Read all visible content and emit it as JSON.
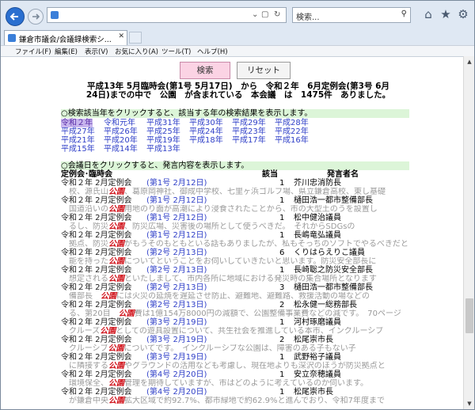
{
  "browser": {
    "address_value": "",
    "search_placeholder": "検索...",
    "tab_title": "鎌倉市議会/会議録検索シ...",
    "menu": [
      "ファイル(F)",
      "編集(E)",
      "表示(V)",
      "お気に入り(A)",
      "ツール(T)",
      "ヘルプ(H)"
    ]
  },
  "buttons": {
    "search": "検索",
    "reset": "リセット"
  },
  "summary": {
    "line1": "平成13年 5月臨時会(第1号 5月17日)　から　令和２年　6月定例会(第3号 6月",
    "line2": "24日)までの中で　公園　が含まれている　本会議　は　1475件　ありました。"
  },
  "year_notice": "○検索該当年をクリックすると、該当する年の検索結果を表示します。",
  "years": [
    "令和２年",
    "令和元年",
    "平成31年",
    "平成30年",
    "平成29年",
    "平成28年",
    "平成27年",
    "平成26年",
    "平成25年",
    "平成24年",
    "平成23年",
    "平成22年",
    "平成21年",
    "平成20年",
    "平成19年",
    "平成18年",
    "平成17年",
    "平成16年",
    "平成15年",
    "平成14年",
    "平成13年"
  ],
  "day_notice": "○会議日をクリックすると、発言内容を表示します。",
  "table_header": {
    "meeting": "定例会･臨時会",
    "count": "該当",
    "speaker": "発言者名"
  },
  "rows": [
    {
      "meeting": "令和２年 2月定例会",
      "date": "(第1号 2月12日)",
      "count": "1",
      "speaker": "芥川忠消防長",
      "snip_pre": "　校、源氏山",
      "snip_hl": "公園",
      "snip_post": "、葛原岡神社、御成中学校、七里ヶ浜ゴルフ場、県立鎌倉高校、東し基礎"
    },
    {
      "meeting": "令和２年 2月定例会",
      "date": "(第1号 2月12日)",
      "count": "1",
      "speaker": "樋田浩一都市整備部長",
      "snip_pre": "　国道沿いの",
      "snip_hl": "公園",
      "snip_post": "用地のり面が高潮により浸食されたことから、市の大型土のうを設置し"
    },
    {
      "meeting": "令和２年 2月定例会",
      "date": "(第1号 2月12日)",
      "count": "1",
      "speaker": "松中健治議員",
      "snip_pre": "　るし、防災",
      "snip_hl": "公園",
      "snip_post": "、防災広場、災害後の場所として使うべきだ。　それからSDGsの"
    },
    {
      "meeting": "令和２年 2月定例会",
      "date": "(第1号 2月12日)",
      "count": "1",
      "speaker": "長嶋竜弘議員",
      "snip_pre": "　拠点、防災",
      "snip_hl": "公園",
      "snip_post": "がもうそのもともといる話もありましたが、私もそっちのソフトでやるべきだと"
    },
    {
      "meeting": "令和２年 2月定例会",
      "date": "(第2号 2月13日)",
      "count": "6",
      "speaker": "くりはらえりこ議員",
      "snip_pre": "　能を持った",
      "snip_hl": "公園",
      "snip_post": "についてということをお伺いしていきたいと思います。防災安全部長に"
    },
    {
      "meeting": "令和２年 2月定例会",
      "date": "(第2号 2月13日)",
      "count": "1",
      "speaker": "長崎聡之防災安全部長",
      "snip_pre": "　想定される",
      "snip_hl": "公園",
      "snip_post": "といたしまして、市内各所に地域における発災時の集合場所となります"
    },
    {
      "meeting": "令和２年 2月定例会",
      "date": "(第2号 2月13日)",
      "count": "3",
      "speaker": "樋田浩一都市整備部長",
      "snip_pre": "　備部長　",
      "snip_hl": "公園",
      "snip_post": "には火災の延焼を遅延させ防止、避難地、避難路、救援活動の場などの"
    },
    {
      "meeting": "令和２年 2月定例会",
      "date": "(第2号 2月13日)",
      "count": "2",
      "speaker": "松永健一総務部長",
      "snip_pre": "　る、第20目　",
      "snip_hl": "公園",
      "snip_post": "費は1億154万8000円の減額で、公園整備事業費などの減です。　70ページ"
    },
    {
      "meeting": "令和２年 2月定例会",
      "date": "(第3号 2月19日)",
      "count": "1",
      "speaker": "河村琢磨議員",
      "snip_pre": "　クルーズ",
      "snip_hl": "公園",
      "snip_post": "としての遊具設置について、共生社会を推進している本市、インクルーシブ"
    },
    {
      "meeting": "令和２年 2月定例会",
      "date": "(第3号 2月19日)",
      "count": "2",
      "speaker": "松尾崇市長",
      "snip_pre": "　クルーシブ",
      "snip_hl": "公園",
      "snip_post": "についてです。　インクルーシブな公園は、障害のある子もない子"
    },
    {
      "meeting": "令和２年 2月定例会",
      "date": "(第3号 2月19日)",
      "count": "1",
      "speaker": "武野裕子議員",
      "snip_pre": "　に隣接する",
      "snip_hl": "公園",
      "snip_post": "やグラウンドの活用なども考慮し、現在地よりも深沢のほうが防災拠点と"
    },
    {
      "meeting": "令和２年 2月定例会",
      "date": "(第4号 2月20日)",
      "count": "1",
      "speaker": "安立奈穂議員",
      "snip_pre": "　環境保全、",
      "snip_hl": "公園",
      "snip_post": "管理を期待していますが、市はどのように考えているのか伺います。"
    },
    {
      "meeting": "令和２年 2月定例会",
      "date": "(第4号 2月20日)",
      "count": "1",
      "speaker": "松尾崇市長",
      "snip_pre": "　が鎌倉中央",
      "snip_hl": "公園",
      "snip_post": "拡大区域で約92.7%、都市緑地で約62.9%と進んでおり、令和7年度まで"
    }
  ]
}
